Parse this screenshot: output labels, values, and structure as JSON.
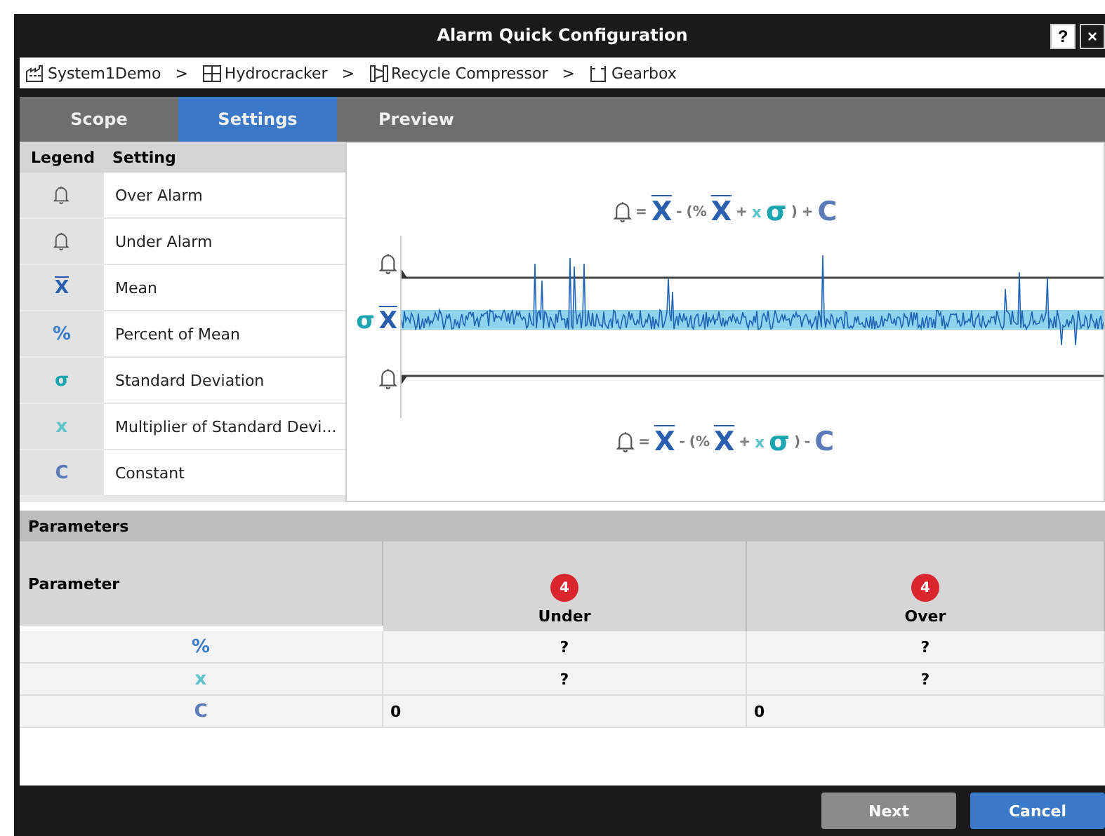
{
  "window": {
    "title": "Alarm Quick Configuration",
    "buttons": [
      "?",
      "×"
    ]
  },
  "breadcrumb": [
    {
      "kind": "factory",
      "label": "System1Demo"
    },
    {
      "kind": "grid",
      "label": "Hydrocracker"
    },
    {
      "kind": "compressor",
      "label": "Recycle Compressor"
    },
    {
      "kind": "gearbox",
      "label": "Gearbox"
    }
  ],
  "breadcrumb_separator": ">",
  "tabs": [
    {
      "label": "Scope",
      "selected": false
    },
    {
      "label": "Settings",
      "selected": true
    },
    {
      "label": "Preview",
      "selected": false
    }
  ],
  "legend": {
    "columns": [
      "Legend",
      "Setting"
    ],
    "rows": [
      {
        "kind": "bell",
        "setting": "Over Alarm"
      },
      {
        "kind": "bell",
        "setting": "Under Alarm"
      },
      {
        "kind": "mean",
        "symbol": "X",
        "color": "#2a5fb0",
        "setting": "Mean"
      },
      {
        "kind": "text",
        "symbol": "%",
        "color": "#3a7cc8",
        "setting": "Percent of Mean"
      },
      {
        "kind": "text",
        "symbol": "σ",
        "color": "#1aa5b0",
        "setting": "Standard Deviation"
      },
      {
        "kind": "text",
        "symbol": "x",
        "color": "#5fc4cc",
        "setting": "Multiplier of Standard Devi..."
      },
      {
        "kind": "text",
        "symbol": "C",
        "color": "#5a7ab8",
        "setting": "Constant"
      }
    ]
  },
  "preview": {
    "over_formula": [
      {
        "kind": "bell"
      },
      {
        "kind": "op",
        "text": "="
      },
      {
        "kind": "mean",
        "text": "X",
        "color": "#2a5fb0"
      },
      {
        "kind": "op",
        "text": "-"
      },
      {
        "kind": "op",
        "text": "(%"
      },
      {
        "kind": "mean",
        "text": "X",
        "color": "#2a5fb0"
      },
      {
        "kind": "op",
        "text": "+"
      },
      {
        "kind": "small",
        "text": "x",
        "color": "#5fc4cc"
      },
      {
        "kind": "big",
        "text": "σ",
        "color": "#1aa5b0"
      },
      {
        "kind": "op",
        "text": ")"
      },
      {
        "kind": "op",
        "text": "+"
      },
      {
        "kind": "big",
        "text": "C",
        "color": "#5a7ab8"
      }
    ],
    "under_formula": [
      {
        "kind": "bell"
      },
      {
        "kind": "op",
        "text": "="
      },
      {
        "kind": "mean",
        "text": "X",
        "color": "#2a5fb0"
      },
      {
        "kind": "op",
        "text": "-"
      },
      {
        "kind": "op",
        "text": "(%"
      },
      {
        "kind": "mean",
        "text": "X",
        "color": "#2a5fb0"
      },
      {
        "kind": "op",
        "text": "+"
      },
      {
        "kind": "small",
        "text": "x",
        "color": "#5fc4cc"
      },
      {
        "kind": "big",
        "text": "σ",
        "color": "#1aa5b0"
      },
      {
        "kind": "op",
        "text": ")"
      },
      {
        "kind": "op",
        "text": "-"
      },
      {
        "kind": "big",
        "text": "C",
        "color": "#5a7ab8"
      }
    ],
    "sigma_label": "σ",
    "mean_label": "X"
  },
  "parameters": {
    "title": "Parameters",
    "columns": [
      {
        "label": "Parameter"
      },
      {
        "label": "Under",
        "badge": "4"
      },
      {
        "label": "Over",
        "badge": "4"
      }
    ],
    "rows": [
      {
        "symbol": "%",
        "color": "#3a7cc8",
        "under": "?",
        "over": "?",
        "kind": "unset"
      },
      {
        "symbol": "x",
        "color": "#5fc4cc",
        "under": "?",
        "over": "?",
        "kind": "unset"
      },
      {
        "symbol": "C",
        "color": "#5a7ab8",
        "under": "0",
        "over": "0",
        "kind": "set"
      }
    ]
  },
  "footer": {
    "buttons": [
      {
        "label": "Next",
        "kind": "secondary"
      },
      {
        "label": "Cancel",
        "kind": "primary"
      }
    ]
  }
}
